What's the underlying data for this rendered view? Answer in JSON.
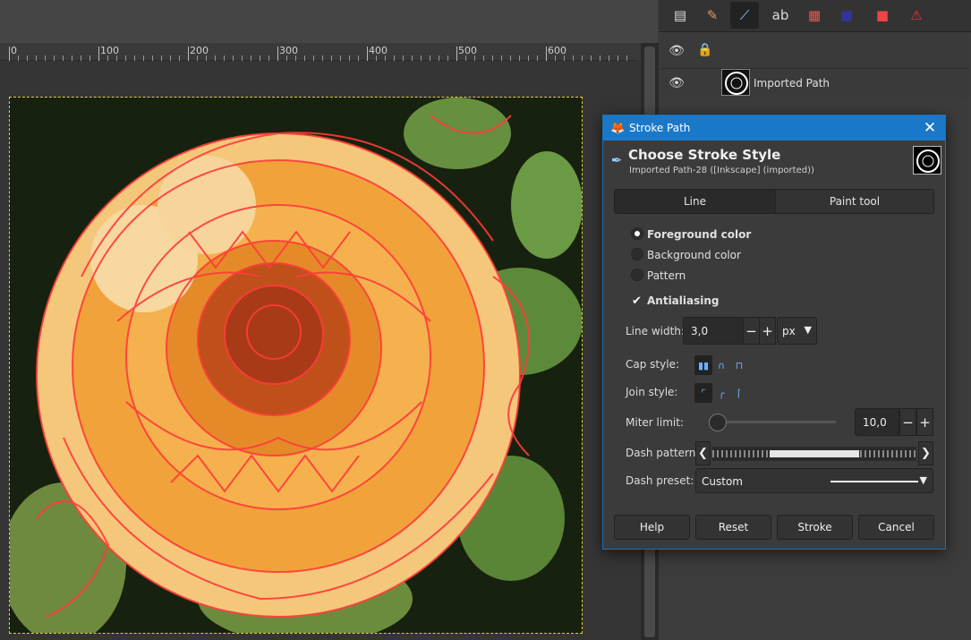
{
  "ruler": {
    "labels": [
      "0",
      "100",
      "200",
      "300",
      "400",
      "500",
      "600"
    ]
  },
  "layers": {
    "imported_path": {
      "name": "Imported Path"
    }
  },
  "dialog": {
    "title": "Stroke Path",
    "header_title": "Choose Stroke Style",
    "header_subtitle": "Imported Path-28 ([Inkscape] (imported))",
    "tabs": [
      {
        "label": "Line",
        "active": true
      },
      {
        "label": "Paint tool",
        "active": false
      }
    ],
    "fill_options": [
      {
        "label": "Foreground color",
        "selected": true
      },
      {
        "label": "Background color",
        "selected": false
      },
      {
        "label": "Pattern",
        "selected": false
      }
    ],
    "antialiasing": {
      "label": "Antialiasing",
      "checked": true
    },
    "line_width": {
      "label": "Line width:",
      "value": "3,0",
      "unit": "px"
    },
    "cap_style": {
      "label": "Cap style:",
      "selected": "butt"
    },
    "join_style": {
      "label": "Join style:",
      "selected": "miter"
    },
    "miter_limit": {
      "label": "Miter limit:",
      "value": "10,0"
    },
    "dash_pattern": {
      "label": "Dash pattern:"
    },
    "dash_preset": {
      "label": "Dash preset:",
      "value": "Custom"
    },
    "buttons": {
      "help": "Help",
      "reset": "Reset",
      "stroke": "Stroke",
      "cancel": "Cancel"
    }
  },
  "colors": {
    "titlebar": "#1a78c8",
    "selection_border": "#e5cf3e",
    "stroke_red": "#ff3b3b",
    "petal_orange": "#f2a23a"
  }
}
